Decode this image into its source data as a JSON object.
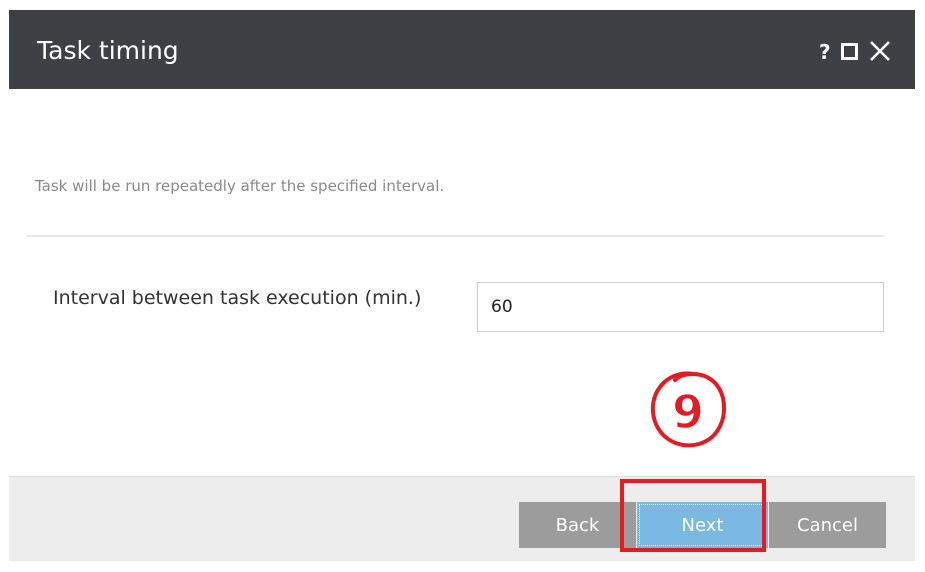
{
  "dialog": {
    "title": "Task timing",
    "help_symbol": "?",
    "icons": [
      "help-icon",
      "maximize-icon",
      "close-icon"
    ]
  },
  "content": {
    "info_text": "Task will be run repeatedly after the specified interval.",
    "interval_label": "Interval between task execution (min.)",
    "interval_value": "60"
  },
  "annotation": {
    "step_number": "9",
    "color": "#e31c24"
  },
  "footer": {
    "back_label": "Back",
    "next_label": "Next",
    "cancel_label": "Cancel"
  },
  "colors": {
    "titlebar": "#3d4145",
    "primary_button": "#79b9e2",
    "secondary_button": "#9c9c9c",
    "footer": "#ededed"
  }
}
